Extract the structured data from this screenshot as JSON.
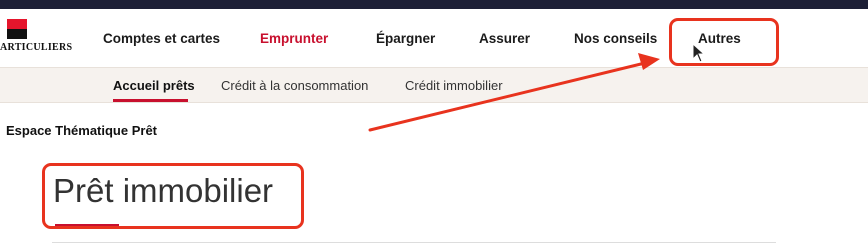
{
  "brand": {
    "text": "ARTICULIERS"
  },
  "nav": {
    "items": [
      {
        "label": "Comptes et cartes"
      },
      {
        "label": "Emprunter"
      },
      {
        "label": "Épargner"
      },
      {
        "label": "Assurer"
      },
      {
        "label": "Nos conseils"
      },
      {
        "label": "Autres"
      }
    ]
  },
  "subnav": {
    "items": [
      {
        "label": "Accueil prêts"
      },
      {
        "label": "Crédit à la consommation"
      },
      {
        "label": "Crédit immobilier"
      }
    ]
  },
  "section_title": "Espace Thématique Prêt",
  "page_title": "Prêt immobilier",
  "colors": {
    "accent": "#c8102e",
    "annotation": "#e8331e",
    "topbar": "#1d1f36"
  },
  "icons": [
    "logo-icon",
    "mouse-cursor-icon",
    "annotation-arrow-icon"
  ]
}
